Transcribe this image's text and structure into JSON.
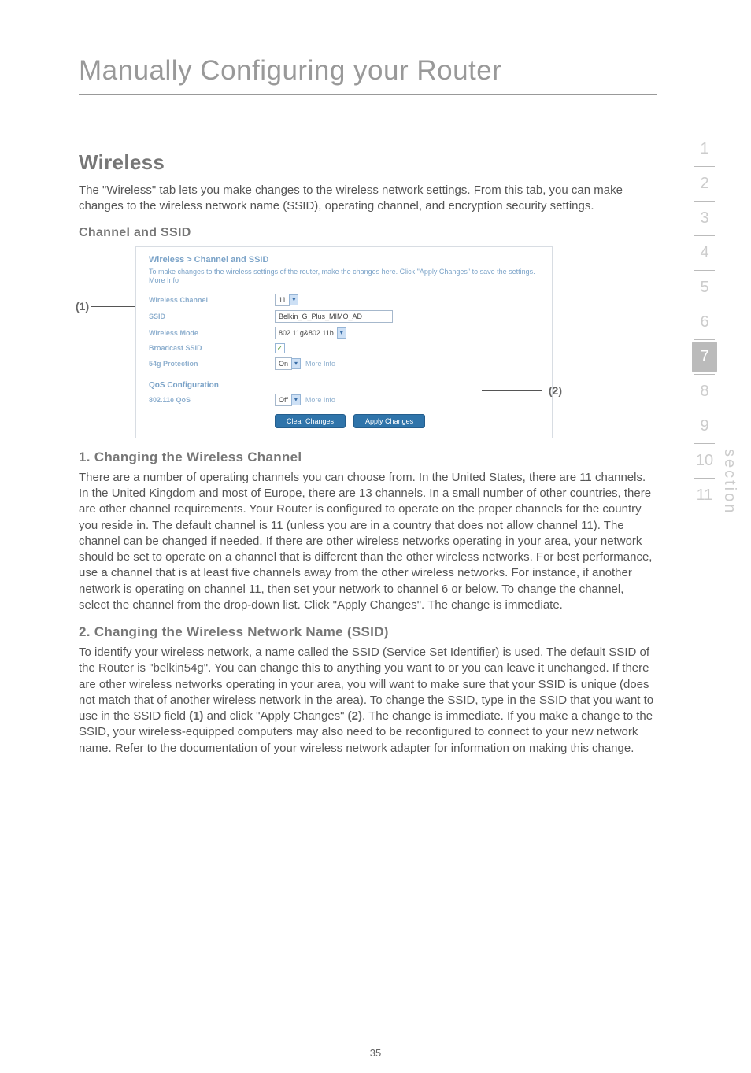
{
  "mainTitle": "Manually Configuring your Router",
  "wireless": {
    "heading": "Wireless",
    "intro": "The \"Wireless\" tab lets you make changes to the wireless network settings. From this tab, you can make changes to the wireless network name (SSID), operating channel, and encryption security settings."
  },
  "channelSsid": {
    "heading": "Channel and SSID"
  },
  "callouts": {
    "c1": "(1)",
    "c2": "(2)"
  },
  "panel": {
    "title": "Wireless > Channel and SSID",
    "subtitle": "To make changes to the wireless settings of the router, make the changes here. Click \"Apply Changes\" to save the settings. More Info",
    "wirelessChannelLabel": "Wireless Channel",
    "wirelessChannelValue": "11",
    "ssidLabel": "SSID",
    "ssidValue": "Belkin_G_Plus_MIMO_AD",
    "modeLabel": "Wireless Mode",
    "modeValue": "802.11g&802.11b",
    "broadcastLabel": "Broadcast SSID",
    "protLabel": "54g Protection",
    "protValue": "On",
    "qosHeading": "QoS Configuration",
    "qosLabel": "802.11e QoS",
    "qosValue": "Off",
    "moreInfo": "More Info",
    "clear": "Clear Changes",
    "apply": "Apply Changes"
  },
  "sec1": {
    "heading": "1. Changing the Wireless Channel",
    "body": "There are a number of operating channels you can choose from. In the United States, there are 11 channels. In the United Kingdom and most of Europe, there are 13 channels. In a small number of other countries, there are other channel requirements. Your Router is configured to operate on the proper channels for the country you reside in. The default channel is 11 (unless you are in a country that does not allow channel 11). The channel can be changed if needed. If there are other wireless networks operating in your area, your network should be set to operate on a channel that is different than the other wireless networks. For best performance, use a channel that is at least five channels away from the other wireless networks. For instance, if another network is operating on channel 11, then set your network to channel 6 or below. To change the channel, select the channel from the drop-down list. Click \"Apply Changes\". The change is immediate."
  },
  "sec2": {
    "heading": "2. Changing the Wireless Network Name (SSID)",
    "bodyA": "To identify your wireless network, a name called the SSID (Service Set Identifier) is used. The default SSID of the Router is \"belkin54g\". You can change this to anything you want to or you can leave it unchanged. If there are other wireless networks operating in your area, you will want to make sure that your SSID is unique (does not match that of another wireless network in the area). To change the SSID, type in the SSID that you want to use in the SSID field ",
    "ref1": "(1)",
    "bodyB": " and click \"Apply Changes\" ",
    "ref2": "(2)",
    "bodyC": ". The change is immediate. If you make a change to the SSID, your wireless-equipped computers may also need to be reconfigured to connect to your new network name. Refer to the documentation of your wireless network adapter for information on making this change."
  },
  "tabs": [
    "1",
    "2",
    "3",
    "4",
    "5",
    "6",
    "7",
    "8",
    "9",
    "10",
    "11"
  ],
  "activeTab": "7",
  "sideLabel": "section",
  "pageNumber": "35"
}
